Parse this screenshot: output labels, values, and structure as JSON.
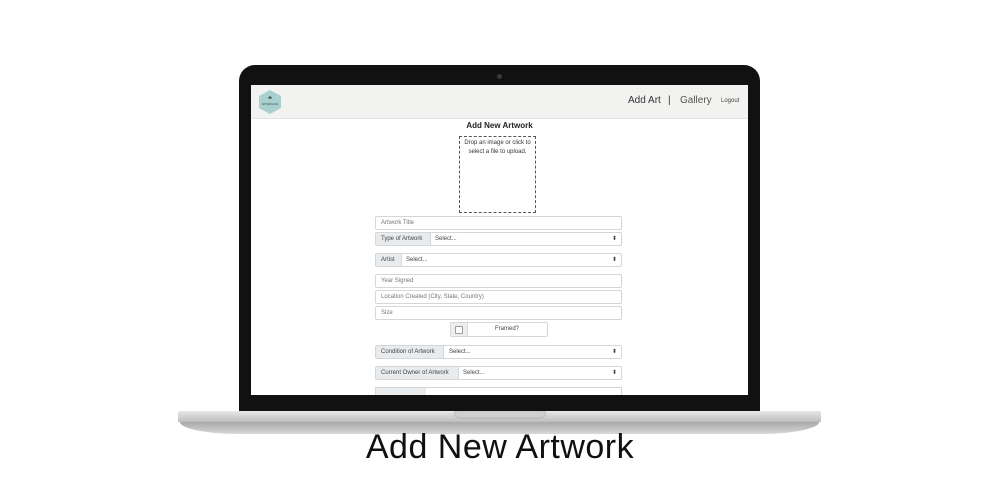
{
  "navbar": {
    "logo_text": "ARTARCHIVE",
    "add_art": "Add Art",
    "separator": "|",
    "gallery": "Gallery",
    "logout": "Logout"
  },
  "form": {
    "title": "Add New Artwork",
    "dropzone_text": "Drop an image or click to select a file to upload.",
    "artwork_title_placeholder": "Artwork Title",
    "type_label": "Type of Artwork",
    "type_value": "Select...",
    "artist_label": "Artist",
    "artist_value": "Select...",
    "year_placeholder": "Year Signed",
    "location_placeholder": "Location Created (City, State, Country)",
    "size_placeholder": "Size",
    "framed_label": "Framed?",
    "condition_label": "Condition of Artwork",
    "condition_value": "Select...",
    "owner_label": "Current Owner of Artwork",
    "owner_value": "Select..."
  },
  "caption": "Add New Artwork",
  "colors": {
    "navbar_bg": "#f2f2f0",
    "logo_color": "#a9cfcf",
    "label_bg": "#e9ecef",
    "laptop_bezel": "#111111"
  }
}
